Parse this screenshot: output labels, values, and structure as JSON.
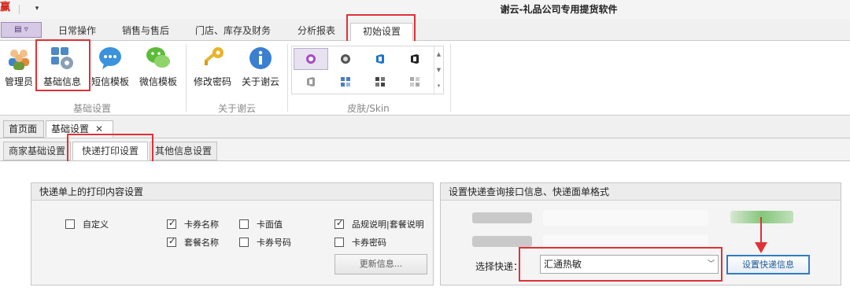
{
  "window": {
    "app_badge": "赢",
    "qa_dropdown": "▾",
    "title": "谢云-礼品公司专用提货软件"
  },
  "ribbon_tabs": [
    "日常操作",
    "销售与售后",
    "门店、库存及财务",
    "分析报表",
    "初始设置"
  ],
  "ribbon": {
    "group1": {
      "label": "基础设置",
      "buttons": [
        "管理员",
        "基础信息",
        "短信模板",
        "微信模板"
      ]
    },
    "group2": {
      "label": "关于谢云",
      "buttons": [
        "修改密码",
        "关于谢云"
      ]
    },
    "group3": {
      "label": "皮肤/Skin"
    }
  },
  "doc_tabs": {
    "home": "首页面",
    "basic": "基础设置",
    "close": "✕"
  },
  "sub_tabs": [
    "商家基础设置",
    "快递打印设置",
    "其他信息设置"
  ],
  "print_panel": {
    "title": "快递单上的打印内容设置",
    "checkboxes": [
      {
        "label": "自定义",
        "checked": false
      },
      {
        "label": "卡券名称",
        "checked": true
      },
      {
        "label": "卡面值",
        "checked": false
      },
      {
        "label": "品规说明|套餐说明",
        "checked": true
      },
      {
        "label": "套餐名称",
        "checked": true
      },
      {
        "label": "卡券号码",
        "checked": false
      },
      {
        "label": "卡券密码",
        "checked": false
      }
    ],
    "update_button": "更新信息..."
  },
  "api_panel": {
    "title": "设置快递查询接口信息、快递面单格式",
    "select_label": "选择快递：",
    "select_value": "汇通热敏",
    "set_button": "设置快递信息"
  },
  "colors": {
    "highlight": "#e03137",
    "accent_blue": "#2f7cc7",
    "menu_purple": "#d6c9e6"
  }
}
